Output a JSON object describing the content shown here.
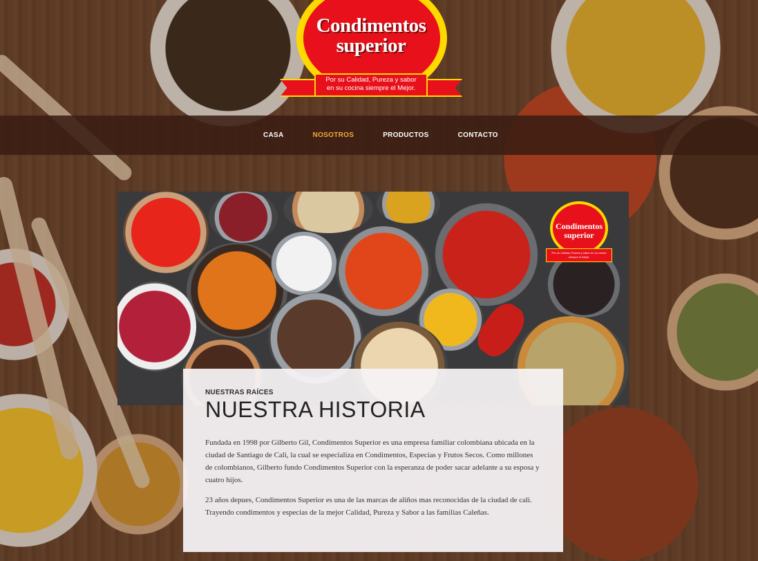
{
  "logo": {
    "line1": "Condimentos",
    "line2": "superior",
    "slogan_line1": "Por su Calidad, Pureza y sabor",
    "slogan_line2": "en su cocina siempre el Mejor.",
    "colors": {
      "red": "#e8111b",
      "yellow": "#ffd800"
    }
  },
  "nav": {
    "items": [
      {
        "label": "CASA",
        "active": false
      },
      {
        "label": "NOSOTROS",
        "active": true
      },
      {
        "label": "PRODUCTOS",
        "active": false
      },
      {
        "label": "CONTACTO",
        "active": false
      }
    ],
    "active_color": "#f2a93b"
  },
  "hero": {
    "logo_line1": "Condimentos",
    "logo_line2": "superior",
    "logo_slogan": "Por su Calidad, Pureza y sabor en su cocina siempre el Mejor."
  },
  "story": {
    "eyebrow": "NUESTRAS RAÍCES",
    "title": "NUESTRA HISTORIA",
    "paragraph1": "Fundada en 1998 por Gilberto Gil, Condimentos Superior es una empresa familiar colombiana ubicada en la ciudad de Santiago de Cali, la cual se especializa en Condimentos, Especias y Frutos Secos. Como millones de colombianos, Gilberto fundo Condimentos Superior con la esperanza de poder sacar adelante a su esposa y cuatro hijos.",
    "paragraph2": "23 años depues, Condimentos Superior es una de las marcas de aliños mas reconocidas de la ciudad de cali. Trayendo condimentos y especias de la mejor Calidad, Pureza y Sabor a las familias Caleñas."
  }
}
